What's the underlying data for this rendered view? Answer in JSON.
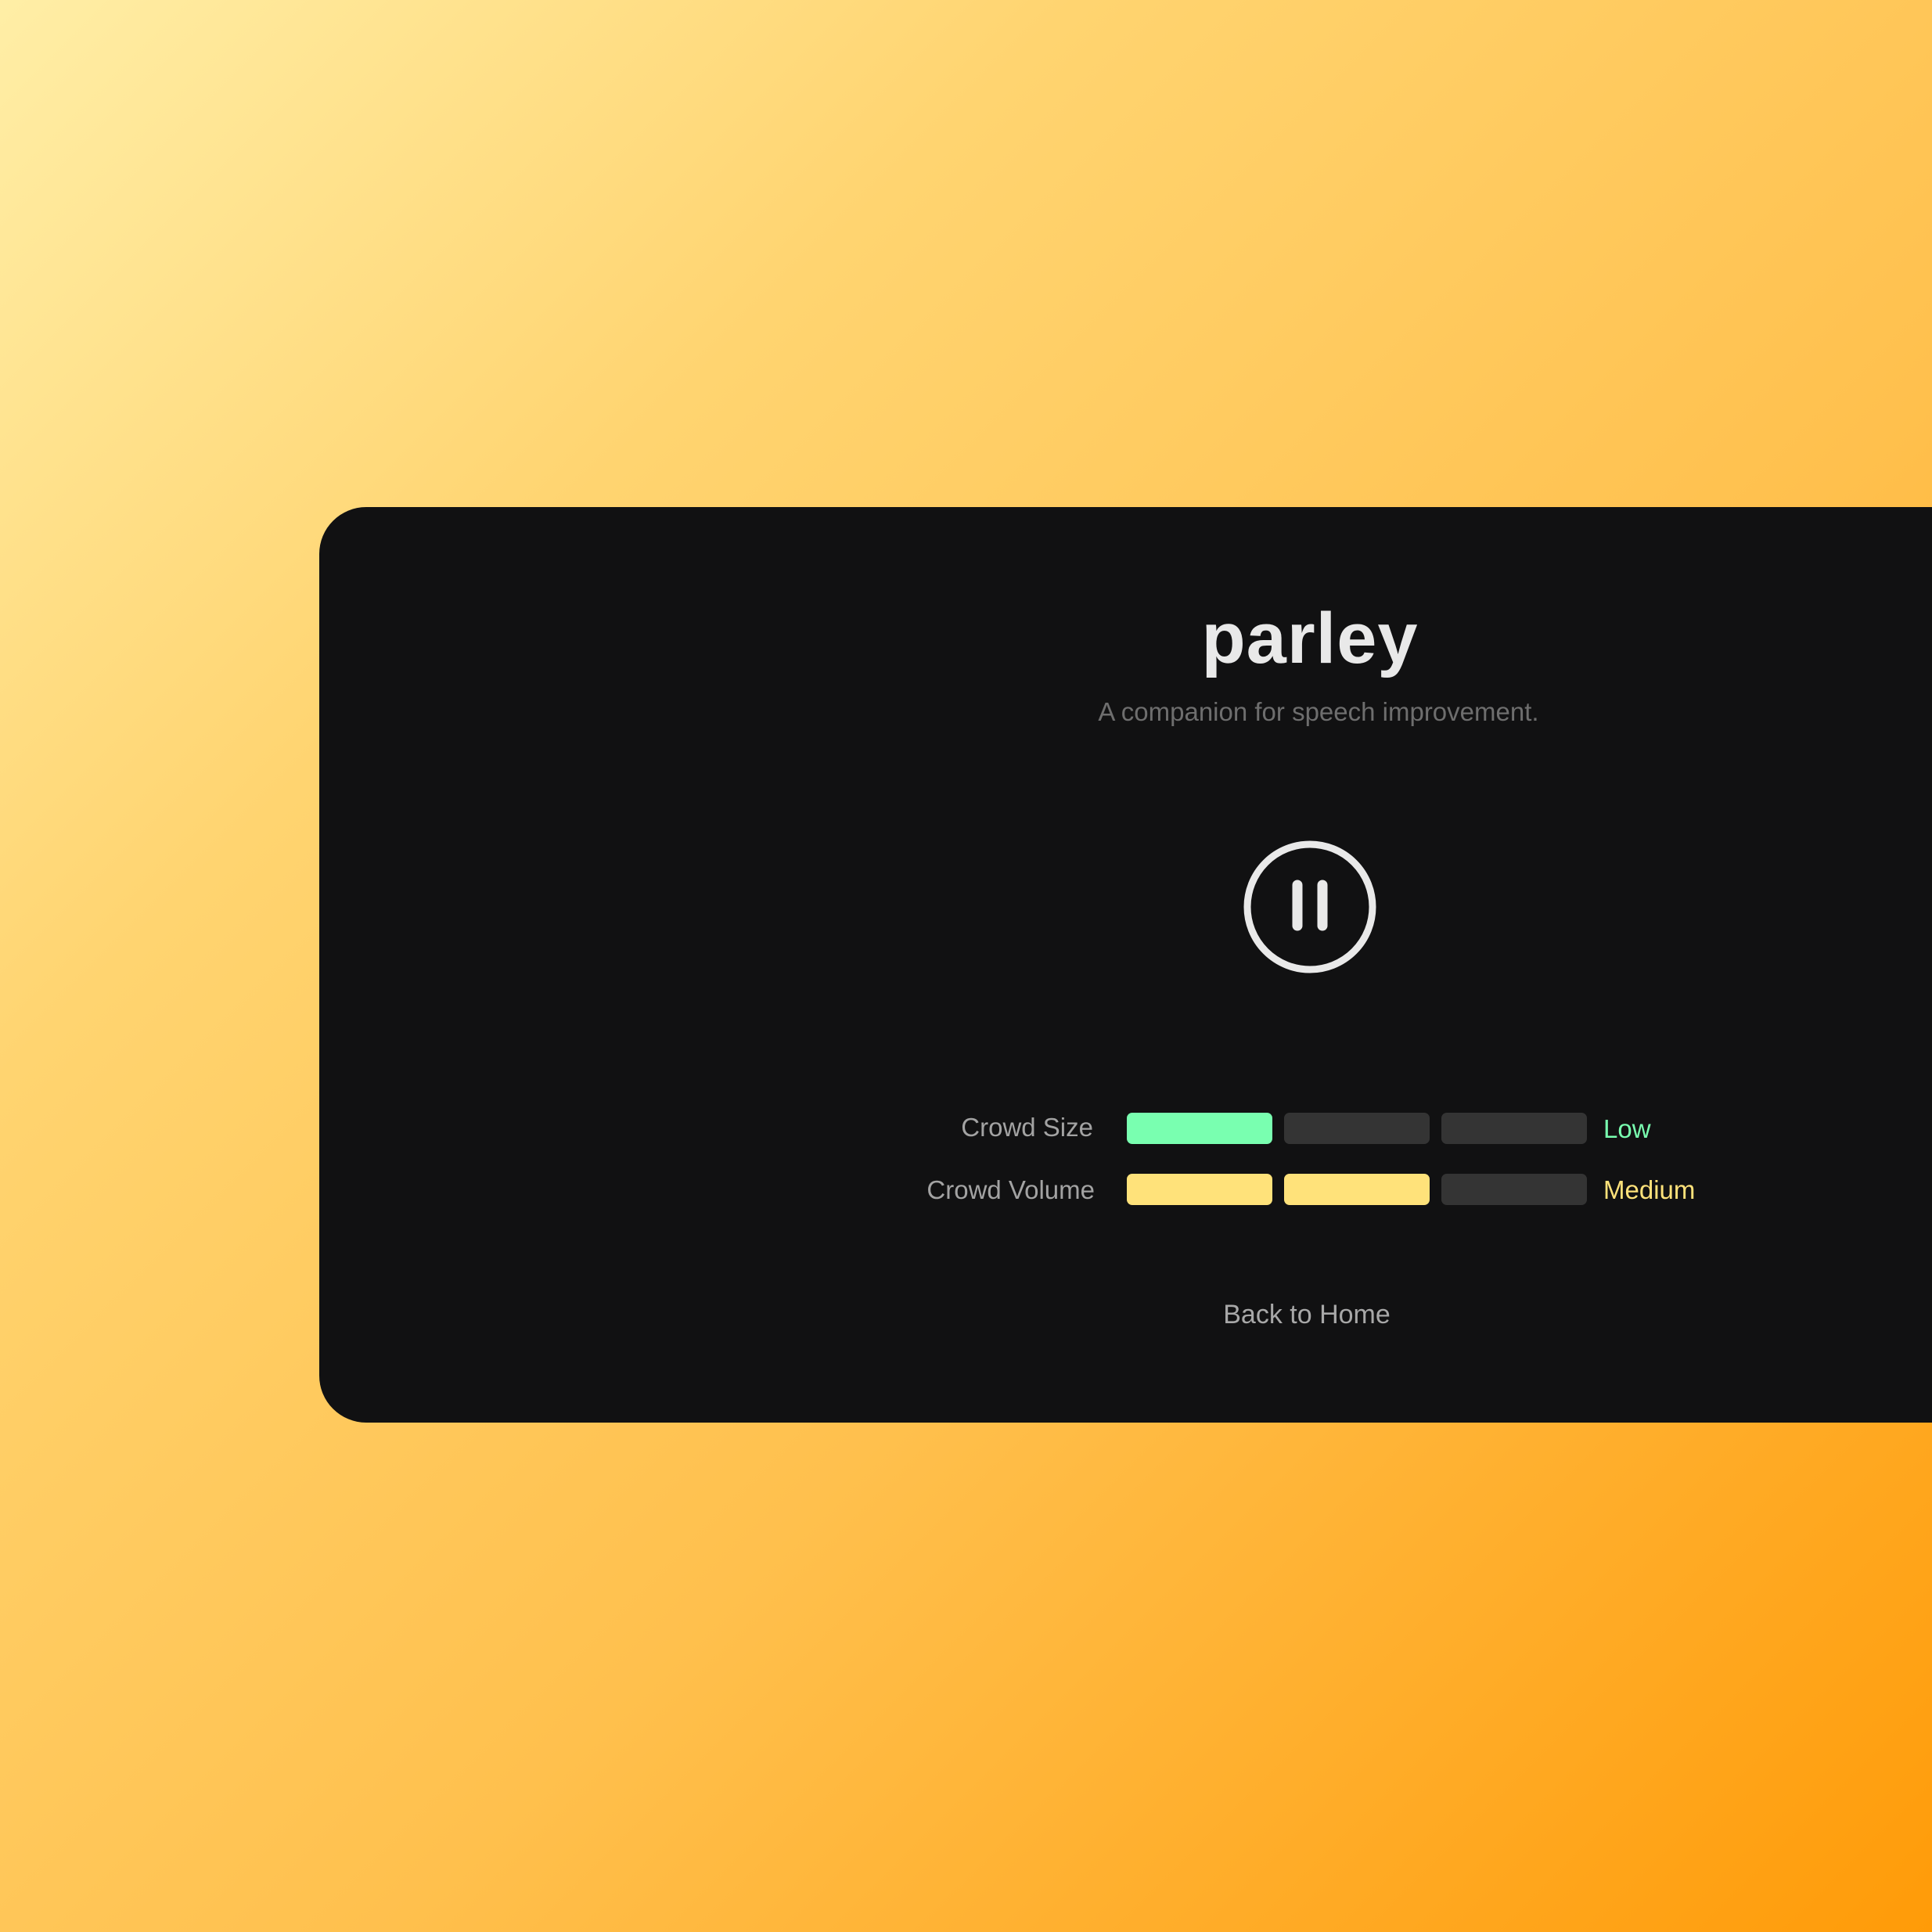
{
  "app": {
    "title": "parley",
    "subtitle": "A companion for speech improvement."
  },
  "controls": {
    "pause_icon": "pause-icon"
  },
  "meters": [
    {
      "label": "Crowd Size",
      "level": "Low",
      "filled_segments": 1,
      "total_segments": 3,
      "color": "#79ffb0"
    },
    {
      "label": "Crowd Volume",
      "level": "Medium",
      "filled_segments": 2,
      "total_segments": 3,
      "color": "#ffe27a"
    }
  ],
  "navigation": {
    "back_label": "Back to Home"
  },
  "colors": {
    "card_background": "#111112",
    "empty_segment": "#343434",
    "title": "#e9e9e9",
    "subtitle": "#6e6e6e"
  }
}
